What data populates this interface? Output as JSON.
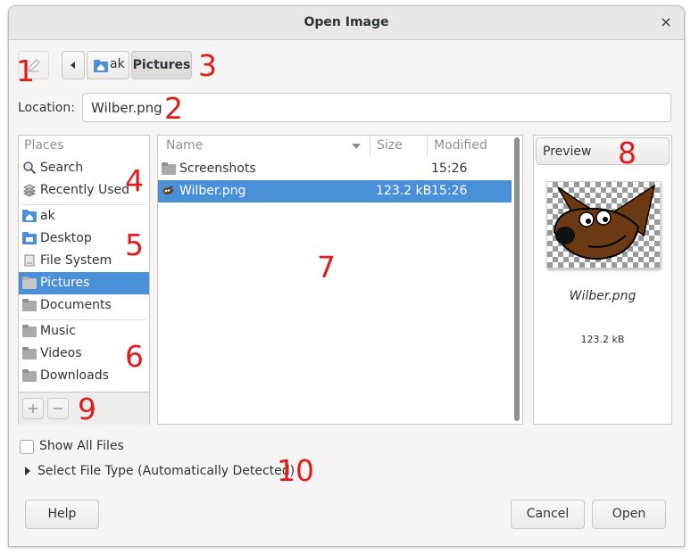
{
  "window": {
    "title": "Open Image",
    "close_glyph": "×"
  },
  "toolbar": {
    "edit_icon": "pencil-icon",
    "back_icon": "left-arrow-icon",
    "path": [
      {
        "label": "ak",
        "icon": "home-folder-icon"
      },
      {
        "label": "Pictures"
      }
    ]
  },
  "location": {
    "label": "Location:",
    "value": "Wilber.png"
  },
  "places": {
    "header": "Places",
    "items": [
      {
        "label": "Search",
        "icon": "search-icon"
      },
      {
        "label": "Recently Used",
        "icon": "recent-icon"
      },
      {
        "label": "ak",
        "icon": "home-folder-icon"
      },
      {
        "label": "Desktop",
        "icon": "desktop-folder-icon"
      },
      {
        "label": "File System",
        "icon": "drive-icon"
      },
      {
        "label": "Pictures",
        "icon": "folder-icon",
        "selected": true
      },
      {
        "label": "Documents",
        "icon": "folder-icon"
      },
      {
        "label": "Music",
        "icon": "folder-icon"
      },
      {
        "label": "Videos",
        "icon": "folder-icon"
      },
      {
        "label": "Downloads",
        "icon": "folder-icon"
      }
    ],
    "add_icon": "plus-icon",
    "remove_icon": "minus-icon"
  },
  "files": {
    "columns": {
      "name": "Name",
      "size": "Size",
      "modified": "Modified"
    },
    "rows": [
      {
        "name": "Screenshots",
        "size": "",
        "modified": "15:26",
        "icon": "folder-icon"
      },
      {
        "name": "Wilber.png",
        "size": "123.2 kB",
        "modified": "15:26",
        "icon": "gimp-image-icon",
        "selected": true
      }
    ]
  },
  "preview": {
    "button": "Preview",
    "filename": "Wilber.png",
    "size": "123.2 kB"
  },
  "options": {
    "show_all": "Show All Files",
    "file_type": "Select File Type (Automatically Detected)"
  },
  "buttons": {
    "help": "Help",
    "cancel": "Cancel",
    "open": "Open"
  },
  "annotations": [
    "1",
    "2",
    "3",
    "4",
    "5",
    "6",
    "7",
    "8",
    "9",
    "10"
  ],
  "colors": {
    "selection": "#4a90d9",
    "annotation": "#e01b1b"
  }
}
